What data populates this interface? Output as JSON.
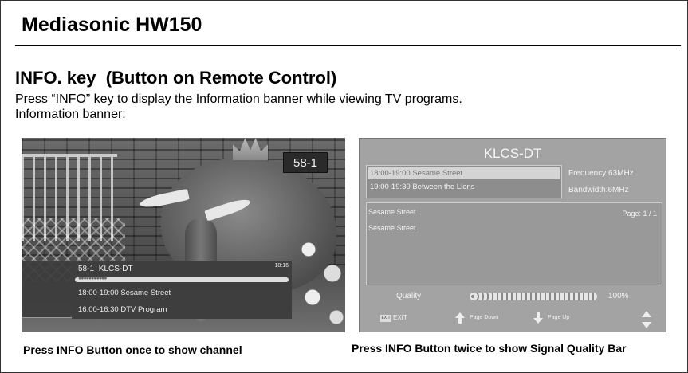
{
  "document": {
    "title": "Mediasonic HW150",
    "section_heading": "INFO. key  (Button on Remote Control)",
    "description_line1": "Press “INFO” key to display the Information banner while viewing TV programs.",
    "description_line2": "Information banner:"
  },
  "screenshot1": {
    "channel_number": "58-1",
    "banner": {
      "channel_line": "58-1 KLCS-DT",
      "clock": "18:16",
      "event1": "18:00-19:00 Sesame Street",
      "event2": "16:00-16:30 DTV Program"
    },
    "caption": "Press INFO Button once to show channel"
  },
  "screenshot2": {
    "title": "KLCS-DT",
    "events": [
      "18:00-19:00 Sesame Street",
      "19:00-19:30 Between the Lions"
    ],
    "frequency": "Frequency:63MHz",
    "bandwidth": "Bandwidth:6MHz",
    "detail_line1": "Sesame Street",
    "detail_line2": "Sesame Street",
    "page_indicator": "Page: 1 / 1",
    "quality_label": "Quality",
    "quality_percent": 100,
    "quality_value": "100%",
    "footer": {
      "exit_key": "EXIT",
      "exit_label": "EXIT",
      "page_down": "Page Down",
      "page_up": "Page Up"
    },
    "caption": "Press INFO Button twice to show Signal Quality Bar"
  }
}
